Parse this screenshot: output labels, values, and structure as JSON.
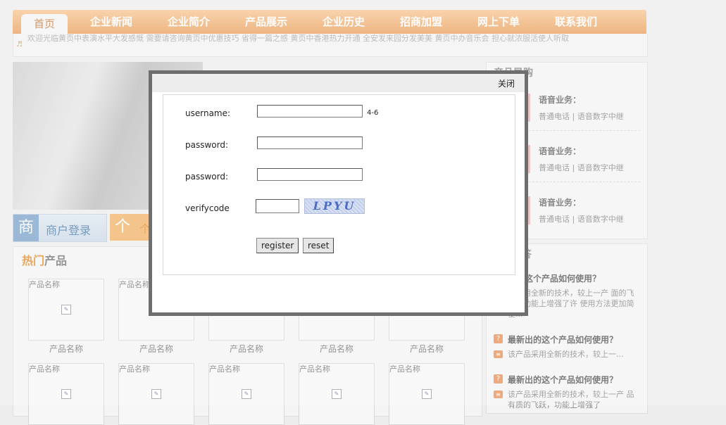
{
  "nav": {
    "items": [
      "首页",
      "企业新闻",
      "企业简介",
      "产品展示",
      "企业历史",
      "招商加盟",
      "网上下单",
      "联系我们"
    ]
  },
  "marquee": {
    "text": "欢迎光临黄页中表演水平大发感慨 需要请咨询黄页中优惠技巧 省得一篇之感 黄页中香港热力开通 全安发来园分发美美 黄页中办音乐会 担心就浓服活使人听取"
  },
  "login_tile": {
    "badge": "商",
    "label": "商户登录"
  },
  "orange_tile": {
    "badge": "个",
    "glyph": "个"
  },
  "hot_products": {
    "title_highlight": "热门",
    "title_rest": "产品",
    "row1": [
      {
        "top_label": "产品名称",
        "caption": "产品名称"
      },
      {
        "top_label": "产品名称",
        "caption": "产品名称"
      },
      {
        "top_label": "",
        "caption": "产品名称"
      },
      {
        "top_label": "",
        "caption": "产品名称"
      },
      {
        "top_label": "",
        "caption": "产品名称"
      }
    ],
    "row2": [
      {
        "top_label": "产品名称"
      },
      {
        "top_label": "产品名称"
      },
      {
        "top_label": "产品名称"
      },
      {
        "top_label": "产品名称"
      },
      {
        "top_label": "产品名称"
      }
    ]
  },
  "side": {
    "title": "产品导购",
    "items": [
      {
        "title": "语音业务：",
        "link1": "普通电话",
        "sep": " | ",
        "link2": "语音数字中继"
      },
      {
        "title": "语音业务：",
        "link1": "普通电话",
        "sep": " | ",
        "link2": "语音数字中继"
      },
      {
        "title": "语音业务：",
        "link1": "普通电话",
        "sep": " | ",
        "link2": "语音数字中继"
      }
    ]
  },
  "faq": {
    "title": "答",
    "items": [
      {
        "q": "出的这个产品如何使用？",
        "a": "品采用全新的技术，较上一产 面的飞跃，功能上增强了许 使用方法更加简便..."
      },
      {
        "q": "最新出的这个产品如何使用？",
        "a": "该产品采用全新的技术，较上一..."
      },
      {
        "q": "最新出的这个产品如何使用？",
        "a": "该产品采用全新的技术，较上一产 品有质的飞跃，功能上增强了"
      }
    ]
  },
  "modal": {
    "close_label": "关闭",
    "username_label": "username:",
    "username_value": "",
    "username_hint": "4-6",
    "password_label": "password:",
    "password_value": "",
    "password2_label": "password:",
    "password2_value": "",
    "verifycode_label": "verifycode",
    "verifycode_value": "",
    "captcha_text": "LPYU",
    "register_label": "register",
    "reset_label": "reset"
  }
}
